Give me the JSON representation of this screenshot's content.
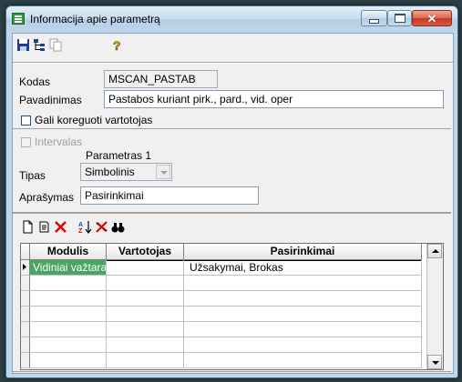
{
  "window": {
    "title": "Informacija apie parametrą",
    "icons": [
      "app-grid-icon",
      "minimize-icon",
      "maximize-icon",
      "close-icon"
    ]
  },
  "toolbar": {
    "icons": [
      "save-icon",
      "tree-view-icon",
      "copy-icon",
      "help-key-icon"
    ]
  },
  "form": {
    "kodas_label": "Kodas",
    "kodas_value": "MSCAN_PASTAB",
    "pavadinimas_label": "Pavadinimas",
    "pavadinimas_value": "Pastabos kuriant pirk., pard., vid. oper",
    "gali_koreguoti_label": "Gali koreguoti vartotojas",
    "gali_koreguoti_checked": false,
    "intervalas_label": "Intervalas",
    "intervalas_checked": false,
    "parametras_header": "Parametras 1",
    "tipas_label": "Tipas",
    "tipas_value": "Simbolinis",
    "aprasymas_label": "Aprašymas",
    "aprasymas_value": "Pasirinkimai"
  },
  "grid_toolbar": {
    "icons": [
      "new-document-icon",
      "edit-document-icon",
      "delete-icon",
      "sort-az-icon",
      "clear-filter-icon",
      "find-binoculars-icon"
    ]
  },
  "grid": {
    "columns": [
      "Modulis",
      "Vartotojas",
      "Pasirinkimai"
    ],
    "rows": [
      {
        "modulis": "Vidiniai važtara",
        "vartotojas": "",
        "pasirinkimai": "Užsakymai, Brokas"
      }
    ]
  },
  "colors": {
    "selection": "#4aa564",
    "close_button": "#c23a22",
    "titlebar": "#bdd5ea"
  }
}
